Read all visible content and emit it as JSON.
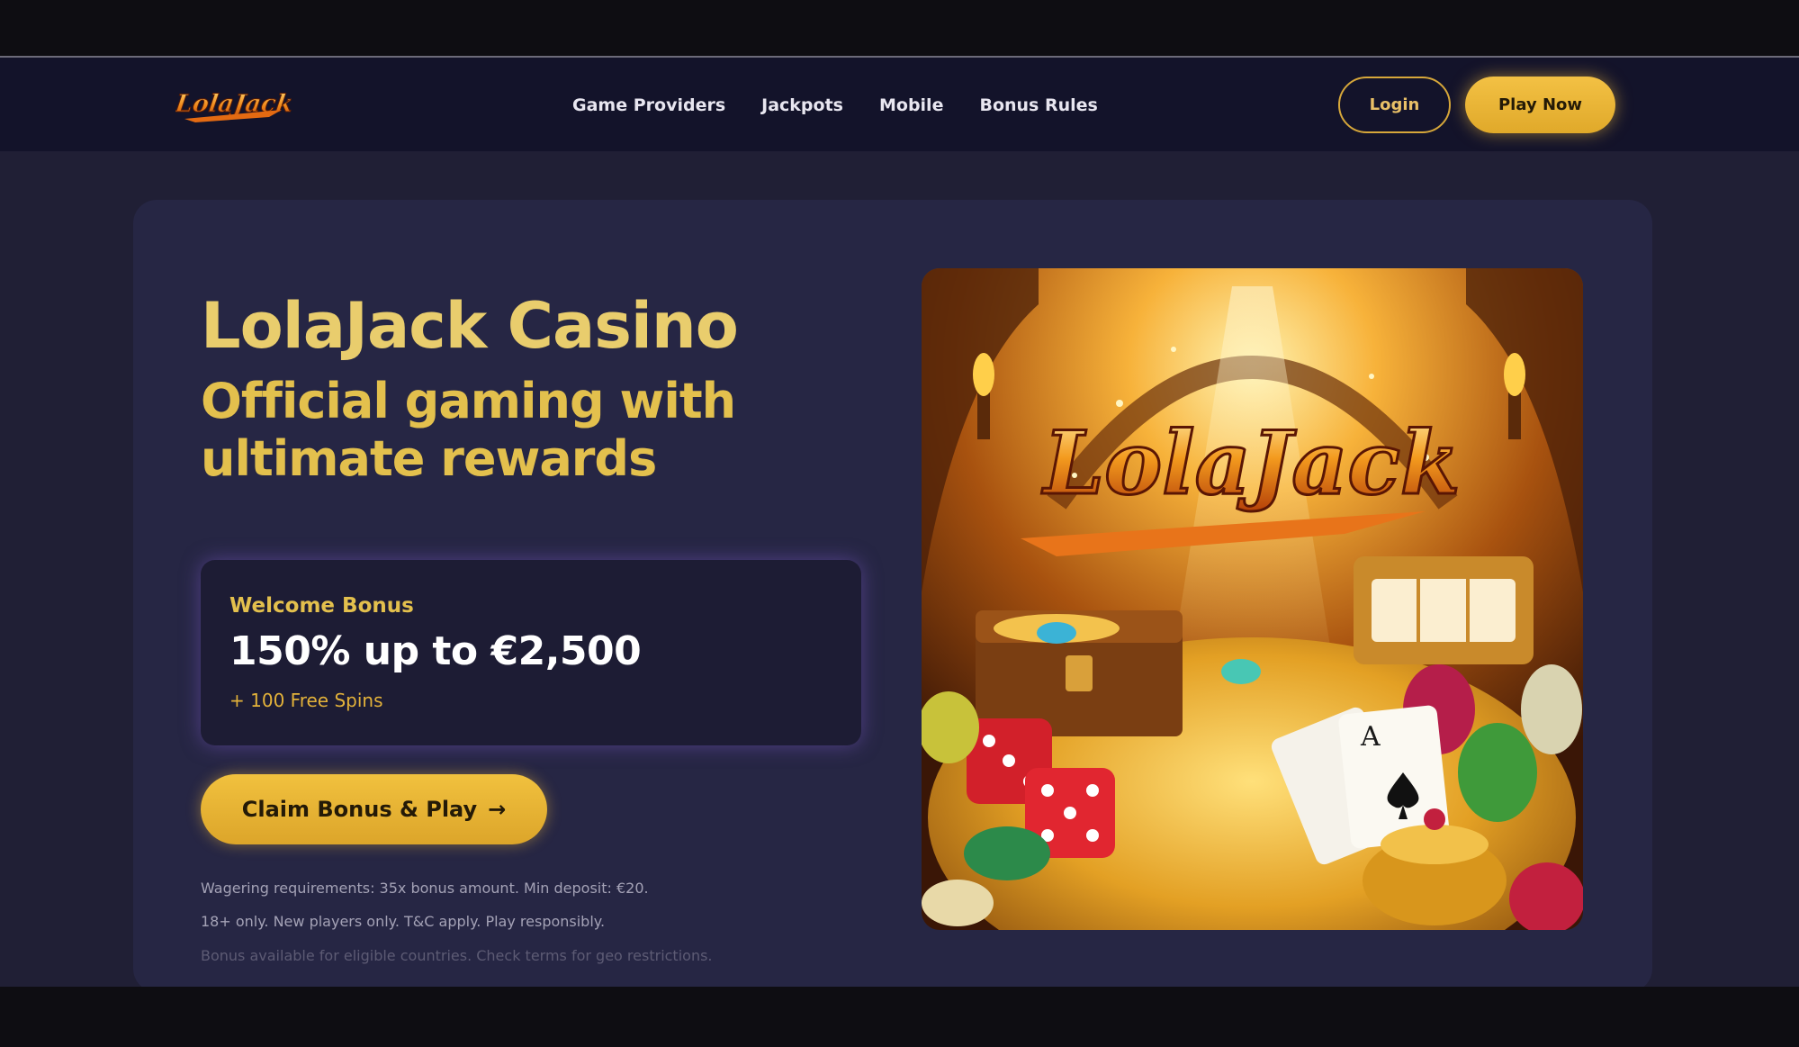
{
  "nav": {
    "logo_text": "LolaJack",
    "links": [
      "Game Providers",
      "Jackpots",
      "Mobile",
      "Bonus Rules"
    ],
    "login_label": "Login",
    "play_label": "Play Now"
  },
  "hero": {
    "title": "LolaJack Casino",
    "subtitle": "Official gaming with ultimate rewards",
    "bonus": {
      "label": "Welcome Bonus",
      "amount": "150% up to €2,500",
      "spins": "+ 100 Free Spins"
    },
    "cta_label": "Claim Bonus & Play",
    "cta_arrow": "→",
    "terms": [
      "Wagering requirements: 35x bonus amount. Min deposit: €20.",
      "18+ only. New players only. T&C apply. Play responsibly.",
      "Bonus available for eligible countries. Check terms for geo restrictions."
    ],
    "image_logo_text": "LolaJack"
  },
  "colors": {
    "accent": "#e3c04d",
    "button": "#f1c13e",
    "background": "#201f35",
    "card": "#262644",
    "navbar": "#13132a"
  },
  "icons": {
    "cta_icon": "arrow-right-icon"
  }
}
